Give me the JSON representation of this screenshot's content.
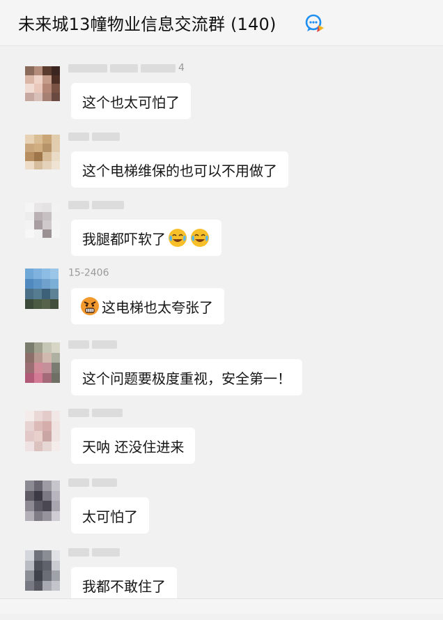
{
  "header": {
    "title": "未来城13幢物业信息交流群 (140)",
    "icon": "group-chat-icon"
  },
  "colors": {
    "background": "#f1f1f1",
    "bubble": "#ffffff",
    "icon_blue": "#1e8ef0",
    "icon_accent": "#f2b31c"
  },
  "messages": [
    {
      "nick_visible": "4",
      "text": "这个也太可怕了"
    },
    {
      "nick_visible": "",
      "text": "这个电梯维保的也可以不用做了"
    },
    {
      "nick_visible": "",
      "text": "我腿都吓软了",
      "emoji": [
        "crying-laughing-emoji-icon",
        "crying-laughing-emoji-icon"
      ]
    },
    {
      "nick_visible": "15-2406",
      "text": "这电梯也太夸张了",
      "lead_emoji": "angry-face-emoji-icon"
    },
    {
      "nick_visible": "",
      "text": "这个问题要极度重视，安全第一！"
    },
    {
      "nick_visible": "",
      "text": "天呐 还没住进来"
    },
    {
      "nick_visible": "",
      "text": "太可怕了"
    },
    {
      "nick_visible": "",
      "text": "我都不敢住了"
    }
  ]
}
